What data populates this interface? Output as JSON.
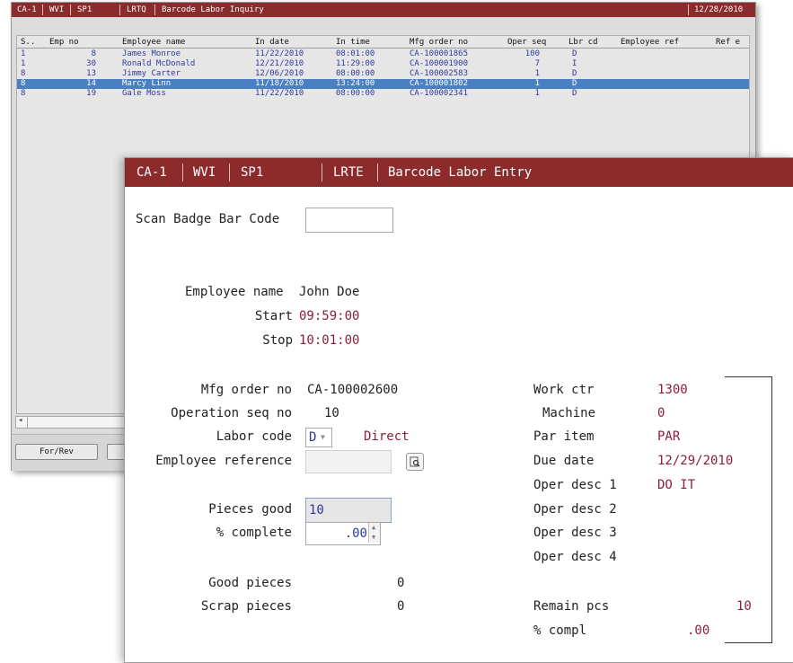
{
  "inquiry": {
    "title_items": [
      "CA-1",
      "WVI",
      "SP1",
      "LRTQ",
      "Barcode Labor Inquiry"
    ],
    "date": "12/28/2010",
    "columns": [
      "S..",
      "Emp no",
      "Employee name",
      "In date",
      "In time",
      "Mfg order no",
      "Oper seq",
      "Lbr cd",
      "Employee ref",
      "Ref e"
    ],
    "rows": [
      {
        "s": "1",
        "emp": "8",
        "name": "James Monroe",
        "in_date": "11/22/2010",
        "in_time": "08:01:00",
        "mfg": "CA-100001865",
        "oper": "100",
        "lbr": "D"
      },
      {
        "s": "1",
        "emp": "30",
        "name": "Ronald McDonald",
        "in_date": "12/21/2010",
        "in_time": "11:29:00",
        "mfg": "CA-100001900",
        "oper": "7",
        "lbr": "I"
      },
      {
        "s": "8",
        "emp": "13",
        "name": "Jimmy Carter",
        "in_date": "12/06/2010",
        "in_time": "08:00:00",
        "mfg": "CA-100002583",
        "oper": "1",
        "lbr": "D"
      },
      {
        "s": "8",
        "emp": "14",
        "name": "Marcy Linn",
        "in_date": "11/18/2010",
        "in_time": "13:24:00",
        "mfg": "CA-100001802",
        "oper": "1",
        "lbr": "D"
      },
      {
        "s": "8",
        "emp": "19",
        "name": "Gale Moss",
        "in_date": "11/22/2010",
        "in_time": "08:00:00",
        "mfg": "CA-100002341",
        "oper": "1",
        "lbr": "D"
      }
    ],
    "selected_row": 3,
    "scroll_left": "◂",
    "button_for_rev": "For/Rev"
  },
  "entry": {
    "title_items": [
      "CA-1",
      "WVI",
      "SP1",
      "LRTE",
      "Barcode Labor Entry"
    ],
    "scan_label": "Scan Badge Bar Code",
    "scan_value": "",
    "employee_name_label": "Employee name",
    "employee_name": "John Doe",
    "start_label": "Start",
    "start": "09:59:00",
    "stop_label": "Stop",
    "stop": "10:01:00",
    "mfg_order_label": "Mfg order no",
    "mfg_order": "CA-100002600",
    "oper_seq_label": "Operation seq no",
    "oper_seq": "10",
    "labor_code_label": "Labor code",
    "labor_code": "D",
    "labor_code_desc": "Direct",
    "employee_ref_label": "Employee reference",
    "employee_ref": "",
    "pieces_good_label": "Pieces good",
    "pieces_good": "10",
    "pct_complete_label": "% complete",
    "pct_complete": ".00",
    "good_pieces_label": "Good pieces",
    "good_pieces": "0",
    "scrap_pieces_label": "Scrap pieces",
    "scrap_pieces": "0",
    "right": {
      "work_ctr_label": "Work ctr",
      "work_ctr": "1300",
      "machine_label": "Machine",
      "machine": "0",
      "par_item_label": "Par item",
      "par_item": "PAR",
      "due_date_label": "Due date",
      "due_date": "12/29/2010",
      "oper_desc1_label": "Oper desc 1",
      "oper_desc1": "DO IT",
      "oper_desc2_label": "Oper desc 2",
      "oper_desc3_label": "Oper desc 3",
      "oper_desc4_label": "Oper desc 4",
      "remain_pcs_label": "Remain pcs",
      "remain_pcs": "10",
      "pct_compl_label": "% compl",
      "pct_compl": ".00"
    }
  },
  "colors": {
    "titlebar": "#8b2b2b",
    "value_text": "#8a1f3a",
    "grid_text": "#2d3a9c",
    "selection": "#4a7fc1"
  }
}
